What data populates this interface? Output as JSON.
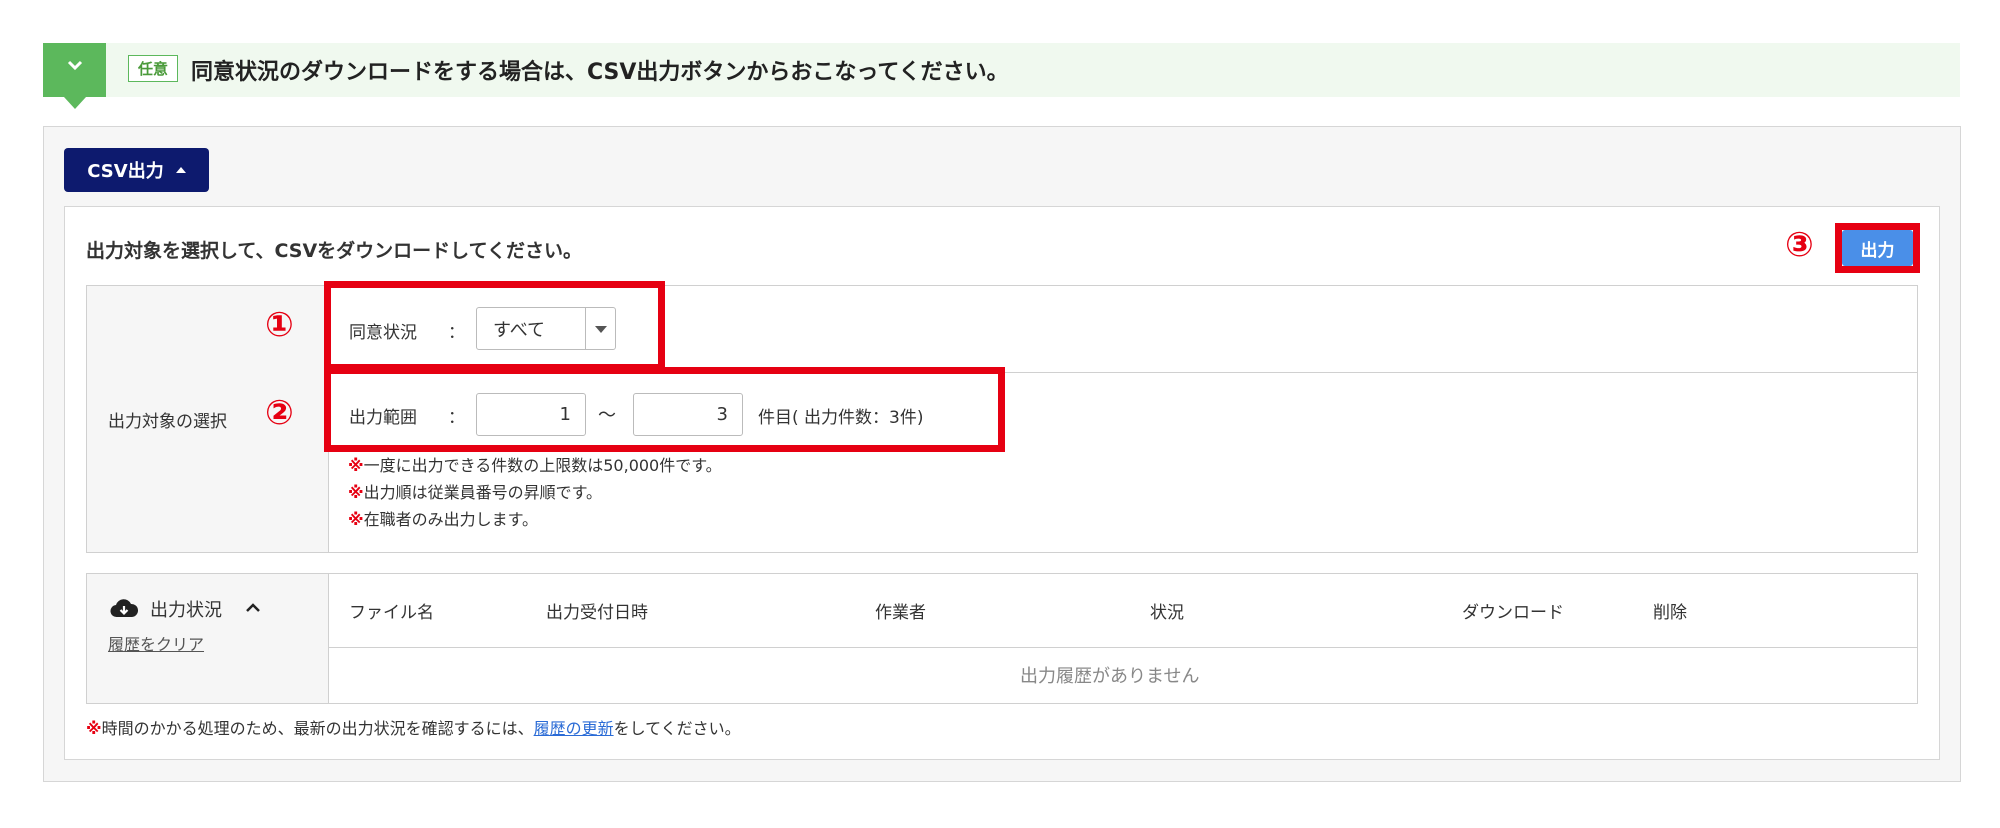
{
  "banner": {
    "badge": "任意",
    "text": "同意状況のダウンロードをする場合は、CSV出力ボタンからおこなってください。"
  },
  "csv_toggle": {
    "label": "CSV出力"
  },
  "instruction": "出力対象を選択して、CSVをダウンロードしてください。",
  "output_button": {
    "label": "出力"
  },
  "markers": {
    "one": "①",
    "two": "②",
    "three": "③"
  },
  "selection": {
    "header": "出力対象の選択",
    "consent": {
      "label": "同意状況",
      "colon": "：",
      "selected": "すべて"
    },
    "range": {
      "label": "出力範囲",
      "colon": "：",
      "from": "1",
      "tilde": "〜",
      "to": "3",
      "suffix": "件目( 出力件数：3件)"
    },
    "notes": [
      {
        "mark": "※",
        "text": "一度に出力できる件数の上限数は50,000件です。"
      },
      {
        "mark": "※",
        "text": "出力順は従業員番号の昇順です。"
      },
      {
        "mark": "※",
        "text": "在職者のみ出力します。"
      }
    ]
  },
  "status": {
    "title": "出力状況",
    "clear_link": "履歴をクリア",
    "columns": [
      "ファイル名",
      "出力受付日時",
      "作業者",
      "状況",
      "ダウンロード",
      "削除"
    ],
    "empty_message": "出力履歴がありません"
  },
  "bottom_note": {
    "mark": "※",
    "prefix": "時間のかかる処理のため、最新の出力状況を確認するには、",
    "link": "履歴の更新",
    "suffix": "をしてください。"
  },
  "colors": {
    "banner_bg": "#f0f9ef",
    "banner_accent": "#5cb85c",
    "csv_button": "#0d1a6e",
    "output_button": "#4a8fe8",
    "highlight_red": "#e60012"
  }
}
